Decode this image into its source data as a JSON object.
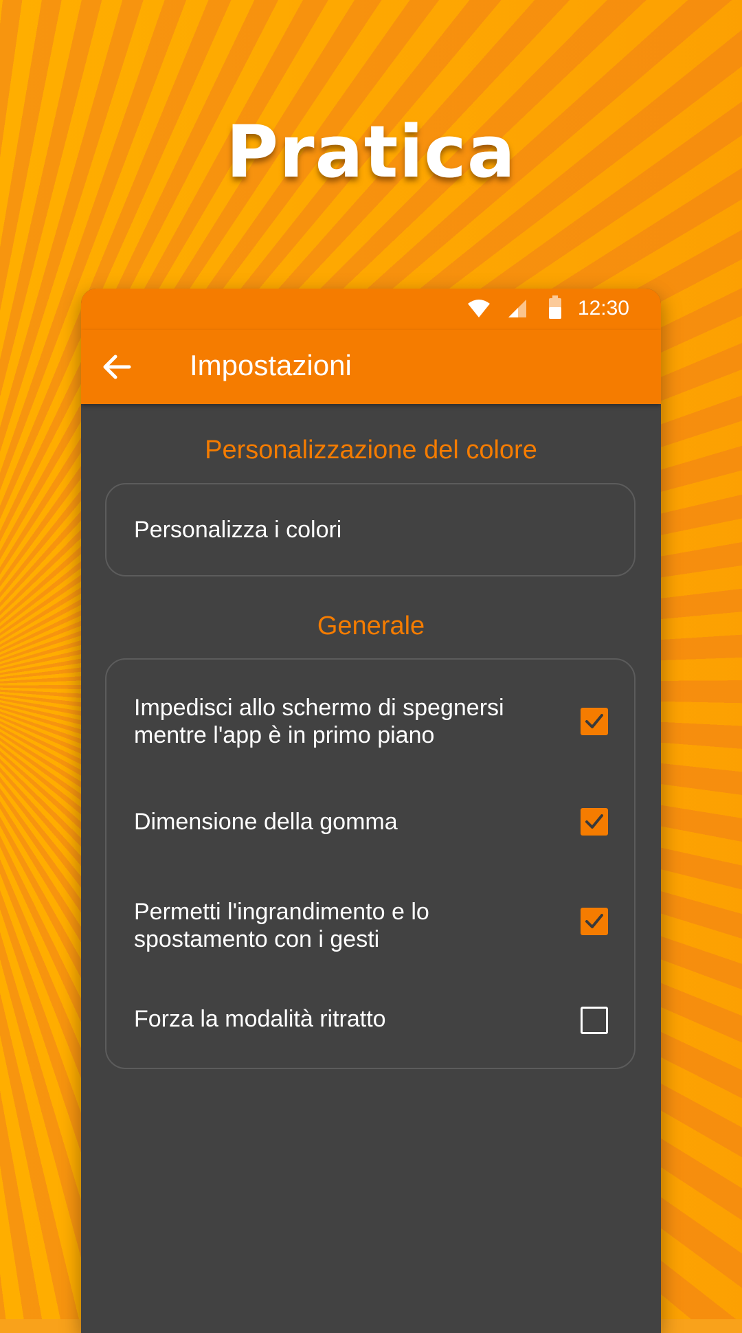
{
  "headline": "Pratica",
  "status_bar": {
    "time": "12:30",
    "icons": [
      "wifi-icon",
      "signal-icon",
      "battery-icon"
    ]
  },
  "app_bar": {
    "back_icon": "arrow-back-icon",
    "title": "Impostazioni"
  },
  "sections": [
    {
      "title": "Personalizzazione del colore",
      "items": [
        {
          "label": "Personalizza i colori"
        }
      ]
    },
    {
      "title": "Generale",
      "items": [
        {
          "label_line1": "Impedisci allo schermo di spegnersi",
          "label_line2": "mentre l'app è in primo piano",
          "checked": true
        },
        {
          "label_line1": "Dimensione della gomma",
          "checked": true
        },
        {
          "label_line1": "Permetti l'ingrandimento e lo",
          "label_line2": "spostamento con i gesti",
          "checked": true
        },
        {
          "label_line1": "Forza la modalità ritratto",
          "checked": false
        }
      ]
    }
  ],
  "colors": {
    "accent": "#f57c00",
    "surface": "#424242",
    "card_border": "#5c5c5c",
    "text": "#ffffff"
  }
}
